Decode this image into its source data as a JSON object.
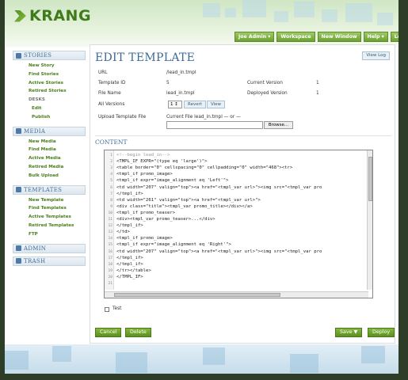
{
  "brand": {
    "logo_text": "KRANG"
  },
  "topnav": [
    "Joe Admin ▾",
    "Workspace",
    "New Window",
    "Help ▾",
    "Log Out"
  ],
  "sidebar": {
    "stories": {
      "title": "STORIES",
      "items": [
        "New Story",
        "Find Stories",
        "Active Stories",
        "Retired Stories"
      ],
      "desks_label": "DESKS",
      "desk_items": [
        "Edit",
        "Publish"
      ]
    },
    "media": {
      "title": "MEDIA",
      "items": [
        "New Media",
        "Find Media",
        "Active Media",
        "Retired Media",
        "Bulk Upload"
      ]
    },
    "templates": {
      "title": "TEMPLATES",
      "items": [
        "New Template",
        "Find Templates",
        "Active Templates",
        "Retired Templates",
        "FTP"
      ]
    },
    "admin": {
      "title": "ADMIN"
    },
    "trash": {
      "title": "TRASH"
    }
  },
  "page": {
    "title": "EDIT TEMPLATE",
    "view_log": "View Log",
    "url_label": "URL",
    "url_value": "/lead_in.tmpl",
    "template_id_label": "Template ID",
    "template_id_value": "5",
    "current_version_label": "Current Version",
    "current_version_value": "1",
    "file_name_label": "File Name",
    "file_name_value": "lead_in.tmpl",
    "deployed_version_label": "Deployed Version",
    "deployed_version_value": "1",
    "all_versions_label": "All Versions",
    "version_select": "1",
    "revert_label": "Revert",
    "view_label": "View",
    "upload_label": "Upload Template File",
    "current_file_text": "Current File lead_in.tmpl — or —",
    "browse_label": "Browse...",
    "content_label": "CONTENT",
    "test_label": "Test"
  },
  "code": {
    "line_numbers": [
      "1",
      "2",
      "3",
      "4",
      "5",
      "6",
      "7",
      "8",
      "9",
      "10",
      "11",
      "12",
      "13",
      "14",
      "15",
      "16",
      "17",
      "18",
      "19",
      "20",
      "21"
    ],
    "lines": [
      "<!--begin lead_in-->",
      "<TMPL_IF EXPR=\"(type eq 'large')\">",
      "<table border=\"0\" cellspacing=\"0\" cellpadding=\"0\" width=\"468\"><tr>",
      "<tmpl_if promo_image>",
      "<tmpl_if expr=\"image_alignment eq 'Left'\">",
      "<td width=\"207\" valign=\"top\"><a href=\"<tmpl_var url>\"><img src=\"<tmpl_var pro",
      "</tmpl_if>",
      "<td width=\"261\" valign=\"top\"><a href=\"<tmpl_var url>\">",
      "<div class=\"title\"><tmpl_var promo_title></div></a>",
      "<tmpl_if promo_teaser>",
      "<div><tmpl_var promo_teaser>...</div>",
      "</tmpl_if>",
      "</td>",
      "<tmpl_if promo_image>",
      "<tmpl_if expr=\"image_alignment eq 'Right'\">",
      "<td width=\"207\" valign=\"top\"><a href=\"<tmpl_var url>\"><img src=\"<tmpl_var pro",
      "</tmpl_if>",
      "</tmpl_if>",
      "</tr></table>",
      "</TMPL_IF>",
      ""
    ]
  },
  "actions": {
    "cancel": "Cancel",
    "delete": "Delete",
    "save": "Save ▼",
    "deploy": "Deploy"
  }
}
